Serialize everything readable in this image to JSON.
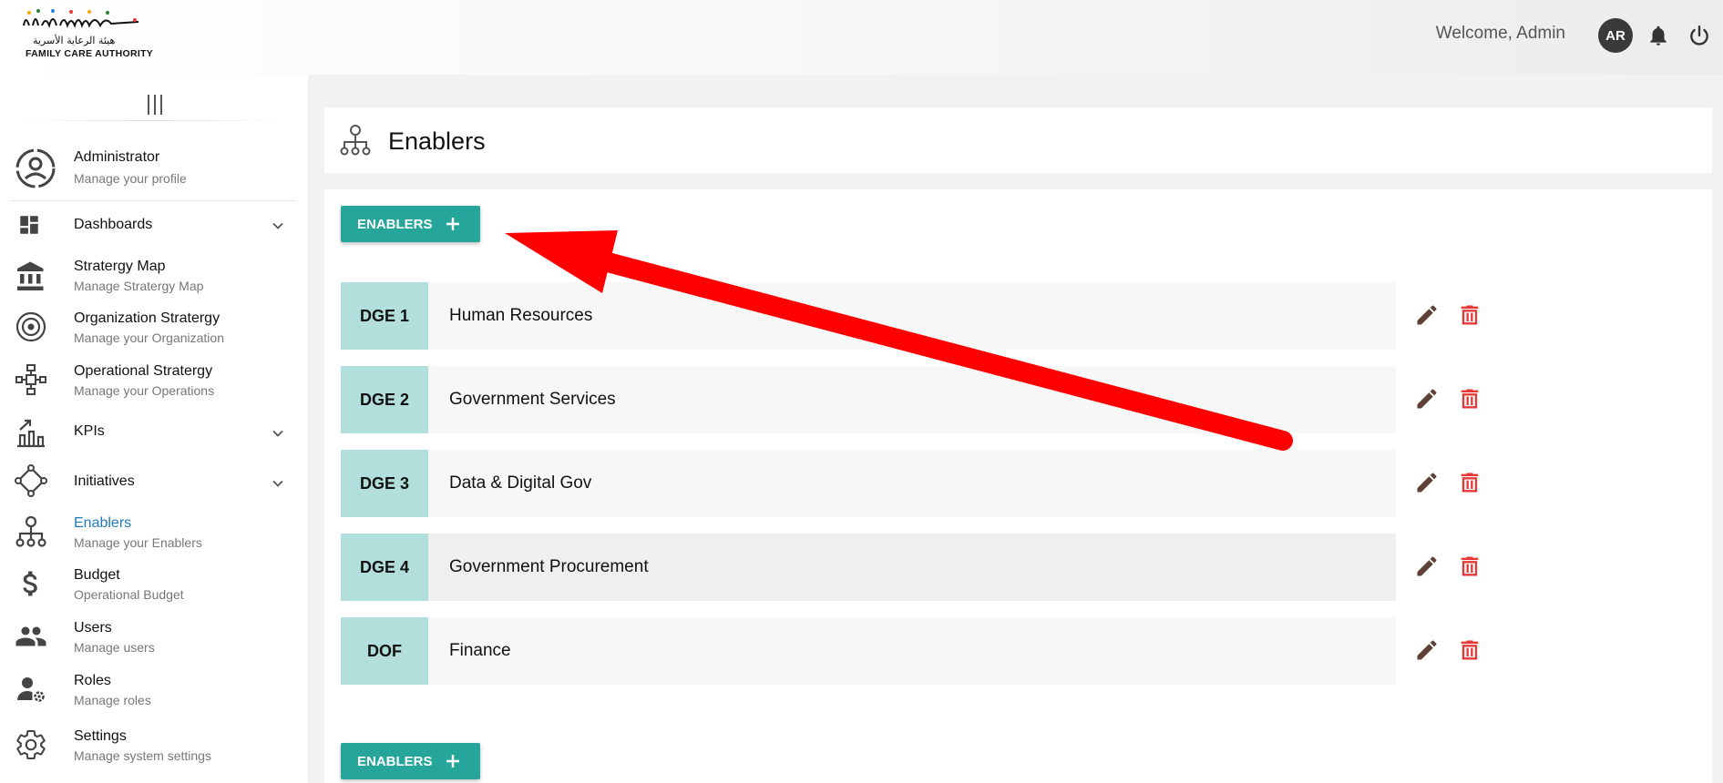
{
  "header": {
    "logo_arabic": "هيئة الرعاية الأسرية",
    "logo_text": "FAMILY CARE AUTHORITY",
    "welcome": "Welcome,  Admin",
    "avatar_initials": "AR"
  },
  "sidebar": {
    "items": [
      {
        "title": "Administrator",
        "subtitle": "Manage your profile",
        "icon": "user-circle-icon"
      },
      {
        "title": "Dashboards",
        "subtitle": "",
        "icon": "dashboard-icon"
      },
      {
        "title": "Stratergy Map",
        "subtitle": "Manage Stratergy Map",
        "icon": "bank-icon"
      },
      {
        "title": "Organization Stratergy",
        "subtitle": "Manage your Organization",
        "icon": "target-icon"
      },
      {
        "title": "Operational Stratergy",
        "subtitle": "Manage your Operations",
        "icon": "network-icon"
      },
      {
        "title": "KPIs",
        "subtitle": "",
        "icon": "chart-arrow-icon"
      },
      {
        "title": "Initiatives",
        "subtitle": "",
        "icon": "diamond-nodes-icon"
      },
      {
        "title": "Enablers",
        "subtitle": "Manage your Enablers",
        "icon": "hierarchy-icon"
      },
      {
        "title": "Budget",
        "subtitle": "Operational Budget",
        "icon": "dollar-icon"
      },
      {
        "title": "Users",
        "subtitle": "Manage users",
        "icon": "users-icon"
      },
      {
        "title": "Roles",
        "subtitle": "Manage roles",
        "icon": "user-gear-icon"
      },
      {
        "title": "Settings",
        "subtitle": "Manage system settings",
        "icon": "gear-icon"
      }
    ]
  },
  "page": {
    "title": "Enablers",
    "add_button_label": "ENABLERS"
  },
  "enablers": [
    {
      "code": "DGE 1",
      "name": "Human Resources"
    },
    {
      "code": "DGE 2",
      "name": "Government Services"
    },
    {
      "code": "DGE 3",
      "name": "Data & Digital Gov"
    },
    {
      "code": "DGE 4",
      "name": "Government Procurement"
    },
    {
      "code": "DOF",
      "name": "Finance"
    }
  ],
  "colors": {
    "accent": "#26a69a",
    "code_bg": "#b2dfdb",
    "edit_icon": "#5d4037",
    "delete_icon": "#e53935",
    "arrow": "#ff0000",
    "active_link": "#1f7ab8"
  }
}
